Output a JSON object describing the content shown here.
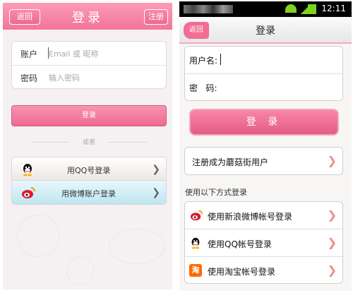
{
  "left": {
    "header": {
      "title": "登录",
      "back_label": "返回",
      "register_label": "注册"
    },
    "form": {
      "account_label": "账户",
      "account_placeholder": "Email 或 昵称",
      "password_label": "密码",
      "password_placeholder": "输入密码"
    },
    "login_label": "登录",
    "or_label": "或者",
    "social": [
      {
        "label": "用QQ号登录",
        "icon": "qq-penguin-icon"
      },
      {
        "label": "用微博账户登录",
        "icon": "weibo-icon"
      }
    ]
  },
  "right": {
    "status_bar": {
      "time": "12:11"
    },
    "header": {
      "title": "登录",
      "back_label": "返回"
    },
    "form": {
      "username_label": "用户名:",
      "password_label": "密   码:"
    },
    "login_label": "登 录",
    "register_row": "注册成为蘑菇街用户",
    "section_label": "使用以下方式登录",
    "social": [
      {
        "label": "使用新浪微博帐号登录",
        "icon": "weibo-icon"
      },
      {
        "label": "使用QQ帐号登录",
        "icon": "qq-penguin-icon"
      },
      {
        "label": "使用淘宝帐号登录",
        "icon": "taobao-icon",
        "glyph": "淘"
      }
    ]
  },
  "colors": {
    "accent_pink": "#f2759a",
    "chevron_pink": "#f08a8a",
    "weibo_blue_row": "#bfe6f1"
  }
}
